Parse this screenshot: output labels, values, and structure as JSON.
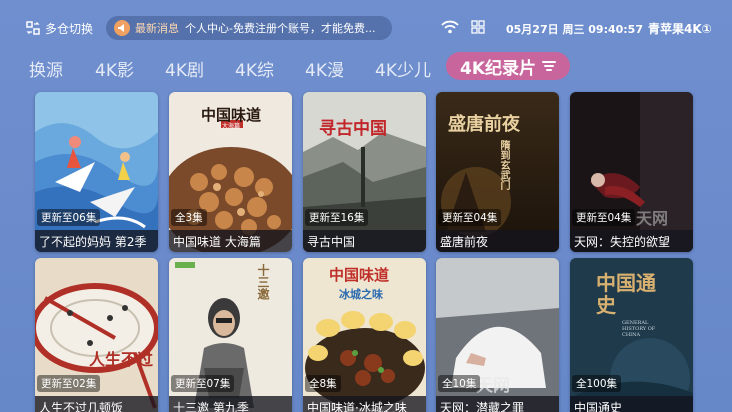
{
  "header": {
    "warehouse_label": "多仓切换",
    "notice_tag": "最新消息",
    "notice_text": "个人中心-免费注册个账号，才能免费...",
    "clock": "05月27日 周三 09:40:57",
    "brand": "青苹果4K①"
  },
  "tabs": [
    {
      "label": "换源"
    },
    {
      "label": "4K影"
    },
    {
      "label": "4K剧"
    },
    {
      "label": "4K综"
    },
    {
      "label": "4K漫"
    },
    {
      "label": "4K少儿"
    },
    {
      "label": "4K纪录片"
    }
  ],
  "cards": [
    {
      "badge": "更新至06集",
      "title": "了不起的妈妈 第2季"
    },
    {
      "badge": "全3集",
      "title": "中国味道 大海篇",
      "poster_title": "中国味道",
      "poster_sub": "大海篇"
    },
    {
      "badge": "更新至16集",
      "title": "寻古中国",
      "poster_title": "寻古中国"
    },
    {
      "badge": "更新至04集",
      "title": "盛唐前夜",
      "poster_title": "盛唐前夜",
      "poster_sub": "隋到玄武门"
    },
    {
      "badge": "更新至04集",
      "title": "天网：失控的欲望",
      "poster_title": "天网"
    },
    {
      "badge": "更新至02集",
      "title": "人生不过几顿饭",
      "poster_title": "人生不过"
    },
    {
      "badge": "更新至07集",
      "title": "十三邀 第九季",
      "poster_title": "十三邀"
    },
    {
      "badge": "全8集",
      "title": "中国味道·冰城之味",
      "poster_title": "中国味道",
      "poster_sub": "冰城之味"
    },
    {
      "badge": "全10集",
      "title": "天网：潜藏之罪",
      "poster_title": "天网"
    },
    {
      "badge": "全100集",
      "title": "中国通史",
      "poster_title": "中国通史",
      "poster_sub": "GENERAL HISTORY OF CHINA"
    }
  ]
}
